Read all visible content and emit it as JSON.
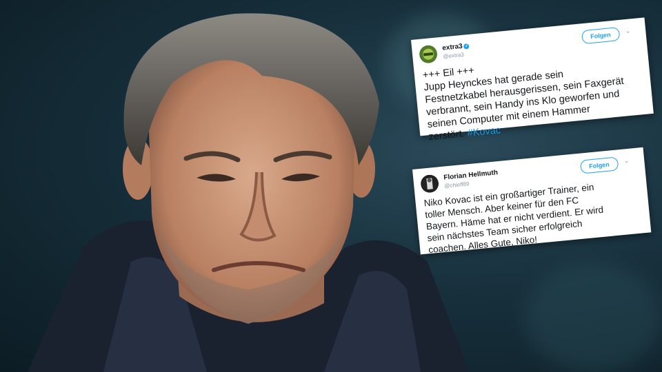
{
  "tweets": [
    {
      "name": "extra3",
      "handle": "@extra3",
      "verified": true,
      "follow_label": "Folgen",
      "lines": [
        "+++ Eil +++",
        "Jupp Heynckes hat gerade sein",
        "Festnetzkabel herausgerissen, sein Faxgerät",
        "verbrannt, sein Handy ins Klo geworfen und",
        "seinen Computer mit einem Hammer"
      ],
      "last_line_text": "zerstört. ",
      "hashtag": "#Kovac"
    },
    {
      "name": "Florian Hellmuth",
      "handle": "@chieff89",
      "verified": false,
      "follow_label": "Folgen",
      "lines": [
        "Niko Kovac ist ein großartiger Trainer, ein",
        "toller Mensch. Aber keiner für den FC",
        "Bayern. Häme hat er nicht verdient. Er wird",
        "sein nächstes Team sicher erfolgreich",
        "coachen. Alles Gute, Niko!"
      ]
    }
  ],
  "icons": {
    "verified": "verified-badge-icon",
    "menu": "chevron-down-icon"
  },
  "colors": {
    "twitter_blue": "#1da1f2",
    "hashtag_blue": "#1b95e0",
    "background_dark": "#17303c"
  }
}
